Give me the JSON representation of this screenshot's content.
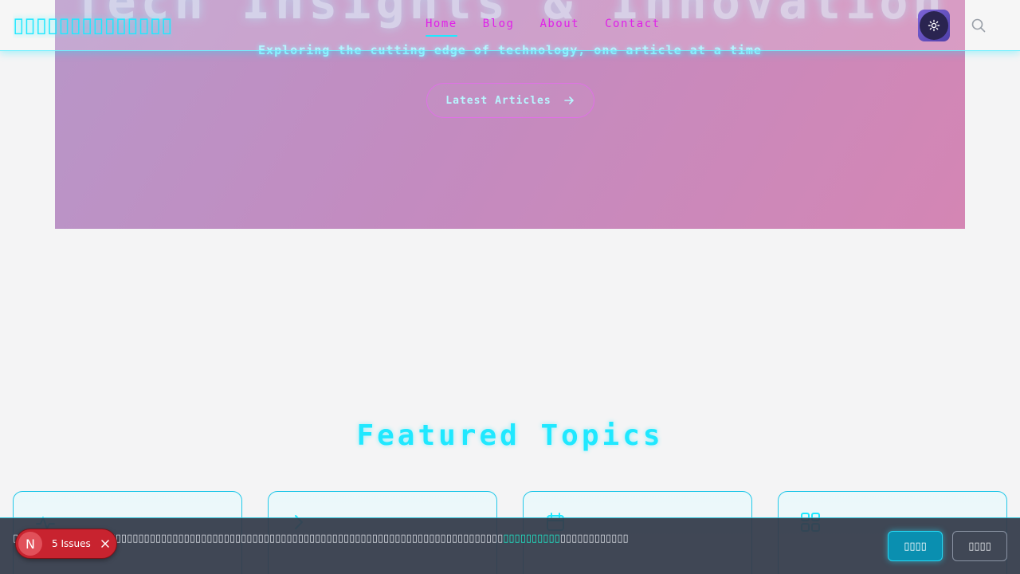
{
  "header": {
    "logo_text": "▯▯▯▯▯▯▯▯▯▯▯▯▯▯",
    "nav": [
      {
        "label": "Home",
        "active": true
      },
      {
        "label": "Blog",
        "active": false
      },
      {
        "label": "About",
        "active": false
      },
      {
        "label": "Contact",
        "active": false
      }
    ],
    "theme_icon": "sun-icon",
    "search_icon": "search-icon"
  },
  "hero": {
    "title": "Tech Insights & Innovation",
    "subtitle": "Exploring the cutting edge of technology, one article at a time",
    "cta_label": "Latest Articles",
    "cta_icon": "arrow-right-icon"
  },
  "featured": {
    "title": "Featured Topics",
    "cards": [
      {
        "icon": "pulse-icon"
      },
      {
        "icon": "chevron-icon"
      },
      {
        "icon": "calendar-icon"
      },
      {
        "icon": "grid-icon"
      }
    ]
  },
  "cookie": {
    "text_before": "▯▯▯▯▯▯▯▯▯▯▯▯▯▯▯▯▯▯▯▯▯▯▯▯▯▯▯▯▯▯▯▯▯▯▯▯▯▯▯▯▯▯▯▯▯▯▯▯▯▯▯▯▯▯▯▯▯▯▯▯▯▯▯▯▯▯▯▯▯▯▯▯▯▯▯▯▯▯▯▯▯▯▯▯▯▯",
    "link_text": "▯▯▯▯▯▯▯▯▯▯",
    "text_after": "▯▯▯▯▯▯▯▯▯▯▯▯",
    "accept_label": "▯▯▯▯",
    "decline_label": "▯▯▯▯"
  },
  "dev_badge": {
    "logo": "N",
    "label": "5 Issues"
  },
  "colors": {
    "accent_cyan": "#1fe8ff",
    "nav_magenta": "#e020e8",
    "background": "#f4f4f5"
  }
}
